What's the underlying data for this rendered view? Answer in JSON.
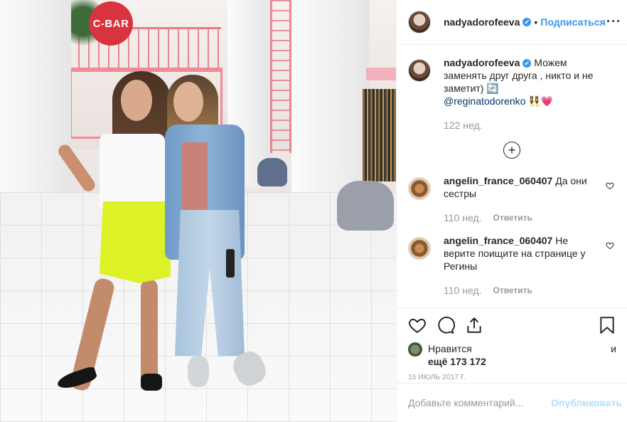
{
  "photo": {
    "sign_text": "C-BAR"
  },
  "header": {
    "username": "nadyadorofeeva",
    "verified_mark": "✔",
    "separator": "•",
    "follow_label": "Подписаться",
    "more_label": "···"
  },
  "caption": {
    "username": "nadyadorofeeva",
    "verified_mark": "✔",
    "text": "Можем заменять друг друга , никто и не заметит) 🔄",
    "mention": "@reginatodorenko",
    "emoji_tail": "👯‍♀️💗",
    "age": "122 нед."
  },
  "load_more_label": "+",
  "comments": [
    {
      "username": "angelin_france_060407",
      "text": "Да они сестры",
      "age": "110 нед.",
      "reply_label": "Ответить"
    },
    {
      "username": "angelin_france_060407",
      "text": "Не верите поищите на странице у Регины",
      "age": "110 нед.",
      "reply_label": "Ответить"
    }
  ],
  "likes": {
    "prefix": "Нравится",
    "and": "и",
    "count_text": "ещё 173 172"
  },
  "date": "15 ИЮЛЬ 2017 Г.",
  "add_comment": {
    "placeholder": "Добавьте комментарий...",
    "publish_label": "Опубликовать"
  },
  "colors": {
    "link_blue": "#3897f0",
    "publish_disabled": "#b2dffc",
    "muted": "#999999"
  }
}
